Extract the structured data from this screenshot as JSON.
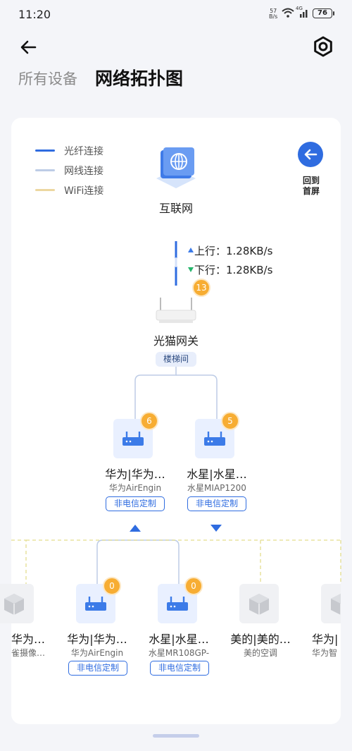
{
  "status": {
    "time": "11:20",
    "net_speed_top": "57",
    "net_speed_bottom": "B/s",
    "signal": "4G",
    "battery": "76"
  },
  "header": {
    "tab_all": "所有设备",
    "tab_topology": "网络拓扑图"
  },
  "legend": [
    {
      "label": "光纤连接",
      "color": "#2f6ce0"
    },
    {
      "label": "网线连接",
      "color": "#bdcce6"
    },
    {
      "label": "WiFi连接",
      "color": "#ecd7a0"
    }
  ],
  "home_button": {
    "line1": "回到",
    "line2": "首屏"
  },
  "internet": {
    "label": "互联网",
    "upload": "上行：1.28KB/s",
    "download": "下行：1.28KB/s"
  },
  "gateway": {
    "badge": "13",
    "label": "光猫网关",
    "room": "楼梯间"
  },
  "routers": [
    {
      "name": "华为|华为…",
      "model": "华为AirEngin",
      "badge": "6",
      "tag": "非电信定制"
    },
    {
      "name": "水星|水星…",
      "model": "水星MIAP1200",
      "badge": "5",
      "tag": "非电信定制"
    }
  ],
  "devices": [
    {
      "name": "华为…",
      "model": "雀摄像…"
    },
    {
      "name": "华为|华为…",
      "model": "华为AirEngin",
      "badge": "0",
      "tag": "非电信定制"
    },
    {
      "name": "水星|水星…",
      "model": "水星MR108GP-",
      "badge": "0",
      "tag": "非电信定制"
    },
    {
      "name": "美的|美的…",
      "model": "美的空调"
    },
    {
      "name": "华为|",
      "model": "华为智"
    }
  ]
}
